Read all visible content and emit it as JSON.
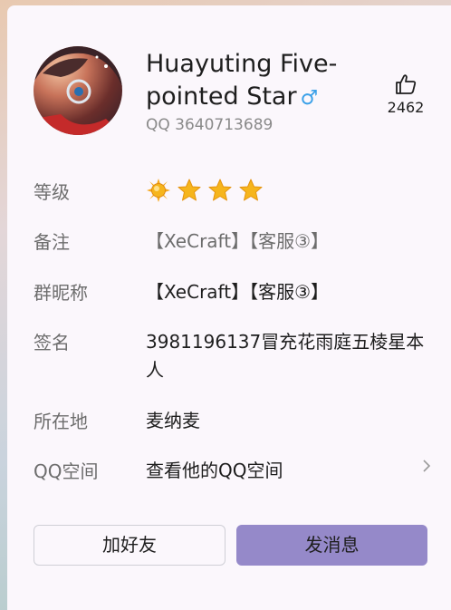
{
  "profile": {
    "name": "Huayuting Five-pointed Star",
    "gender_symbol": "♂",
    "qq_label": "QQ 3640713689",
    "likes": "2462"
  },
  "rows": {
    "level_label": "等级",
    "remark_label": "备注",
    "remark_value": "【XeCraft】【客服③】",
    "nickname_label": "群昵称",
    "nickname_value": "【XeCraft】【客服③】",
    "signature_label": "签名",
    "signature_value": "3981196137冒充花雨庭五棱星本人",
    "location_label": "所在地",
    "location_value": "麦纳麦",
    "qzone_label": "QQ空间",
    "qzone_value": "查看他的QQ空间"
  },
  "level_icons": [
    "sun-icon",
    "star-icon",
    "star-icon",
    "star-icon"
  ],
  "buttons": {
    "add_friend": "加好友",
    "send_message": "发消息"
  },
  "colors": {
    "card_bg": "#fbf7fc",
    "accent_button": "#9589c9",
    "gender_blue": "#3aa0e8",
    "star_yellow": "#f6b51c"
  }
}
